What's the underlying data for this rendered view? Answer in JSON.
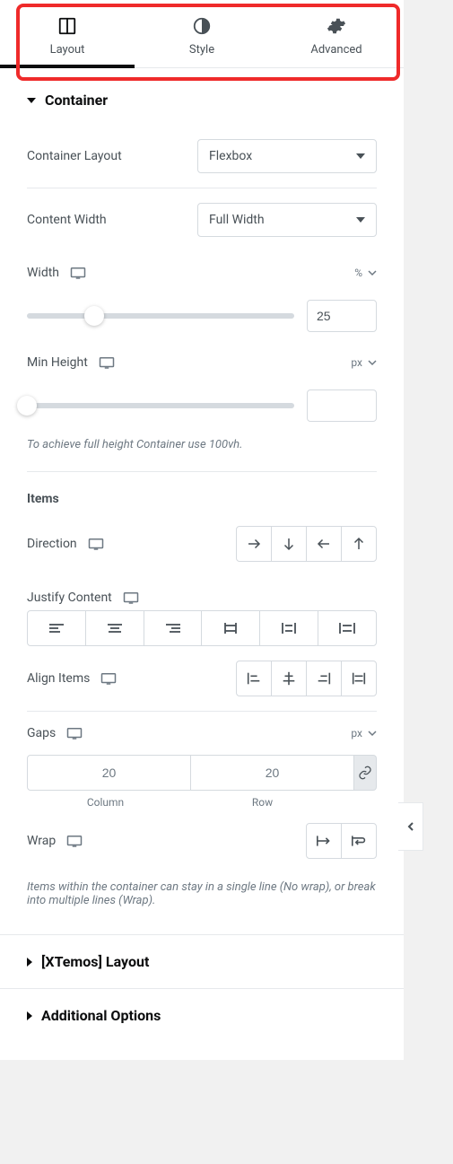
{
  "tabs": {
    "layout": "Layout",
    "style": "Style",
    "advanced": "Advanced"
  },
  "sections": {
    "container": {
      "title": "Container",
      "container_layout": {
        "label": "Container Layout",
        "value": "Flexbox"
      },
      "content_width": {
        "label": "Content Width",
        "value": "Full Width"
      },
      "width": {
        "label": "Width",
        "unit": "%",
        "value": "25"
      },
      "min_height": {
        "label": "Min Height",
        "unit": "px",
        "value": ""
      },
      "hint": "To achieve full height Container use 100vh.",
      "items_heading": "Items",
      "direction": {
        "label": "Direction"
      },
      "justify": {
        "label": "Justify Content"
      },
      "align": {
        "label": "Align Items"
      },
      "gaps": {
        "label": "Gaps",
        "unit": "px",
        "column": "20",
        "row": "20",
        "column_label": "Column",
        "row_label": "Row"
      },
      "wrap": {
        "label": "Wrap",
        "hint": "Items within the container can stay in a single line (No wrap), or break into multiple lines (Wrap)."
      }
    },
    "xtemos": {
      "title": "[XTemos] Layout"
    },
    "additional": {
      "title": "Additional Options"
    }
  }
}
